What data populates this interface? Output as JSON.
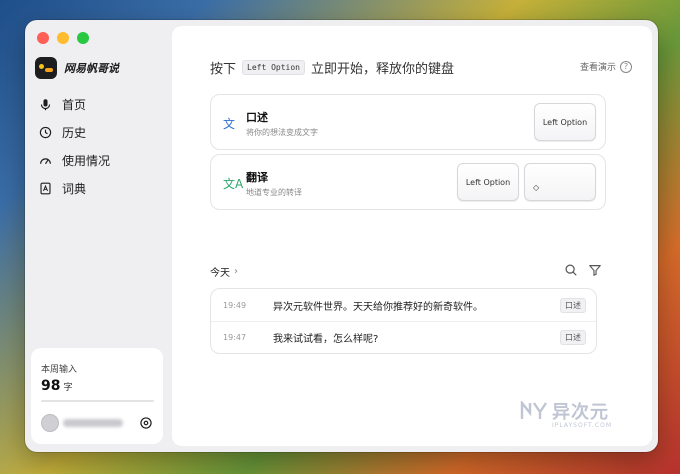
{
  "app": {
    "name": "网易帆哥说"
  },
  "sidebar": {
    "items": [
      {
        "label": "首页",
        "icon": "mic-icon"
      },
      {
        "label": "历史",
        "icon": "clock-icon"
      },
      {
        "label": "使用情况",
        "icon": "gauge-icon"
      },
      {
        "label": "词典",
        "icon": "dictionary-icon"
      }
    ],
    "stats": {
      "label": "本周输入",
      "count": "98",
      "unit": "字",
      "progress": 0.0
    }
  },
  "main": {
    "hero": {
      "prefix": "按下",
      "key": "Left Option",
      "suffix": "立即开始，释放你的键盘"
    },
    "demo_link": "查看演示",
    "cards": [
      {
        "title": "口述",
        "subtitle": "将你的想法变成文字",
        "icon": "文",
        "key": "Left Option",
        "icon_color": "#2f6fd6"
      },
      {
        "title": "翻译",
        "subtitle": "地道专业的转译",
        "icon": "文A",
        "key": "Left Option",
        "extra_key": "◇",
        "icon_color": "#2aa86a"
      }
    ],
    "today": {
      "label": "今天",
      "chevron": "›"
    },
    "history": [
      {
        "time": "19:49",
        "text": "异次元软件世界。天天给你推荐好的新奇软件。",
        "tag": "口述"
      },
      {
        "time": "19:47",
        "text": "我来试试看，怎么样呢?",
        "tag": "口述"
      }
    ]
  },
  "watermark": {
    "text": "异次元",
    "sub": "IPLAYSOFT.COM"
  }
}
